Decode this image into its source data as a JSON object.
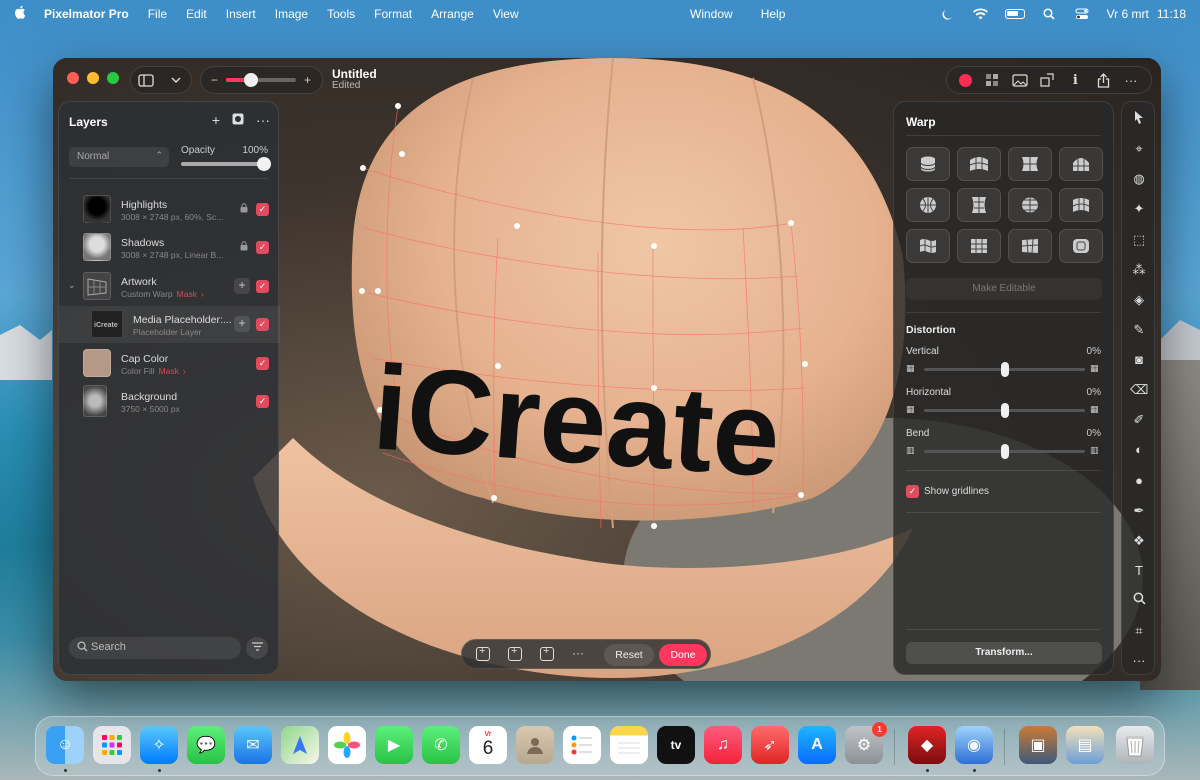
{
  "menubar": {
    "app_name": "Pixelmator Pro",
    "menus": [
      "File",
      "Edit",
      "Insert",
      "Image",
      "Tools",
      "Format",
      "Arrange",
      "View"
    ],
    "center_menus": [
      "Window",
      "Help"
    ],
    "date": "Vr 6 mrt",
    "time": "11:18"
  },
  "window": {
    "title": "Untitled",
    "subtitle": "Edited",
    "zoom_fraction": 0.35
  },
  "layers": {
    "title": "Layers",
    "blend_mode": "Normal",
    "opacity_label": "Opacity",
    "opacity_value": "100%",
    "search_placeholder": "Search",
    "items": [
      {
        "name": "Highlights",
        "desc": "3008 × 2748 px, 60%, Sc...",
        "mask": "",
        "locked": true
      },
      {
        "name": "Shadows",
        "desc": "3008 × 2748 px, Linear B...",
        "mask": "",
        "locked": true
      },
      {
        "name": "Artwork",
        "desc": "Custom Warp",
        "mask": "Mask",
        "locked": false
      },
      {
        "name": "Media Placeholder:...",
        "desc": "Placeholder Layer",
        "mask": "",
        "locked": false
      },
      {
        "name": "Cap Color",
        "desc": "Color Fill",
        "mask": "Mask",
        "locked": false
      },
      {
        "name": "Background",
        "desc": "3750 × 5000 px",
        "mask": "",
        "locked": false
      }
    ]
  },
  "canvas": {
    "artwork_text": "iCreate"
  },
  "warp": {
    "title": "Warp",
    "make_editable": "Make Editable",
    "distortion_title": "Distortion",
    "sliders": [
      {
        "label": "Vertical",
        "value": "0%",
        "fraction": 0.5
      },
      {
        "label": "Horizontal",
        "value": "0%",
        "fraction": 0.5
      },
      {
        "label": "Bend",
        "value": "0%",
        "fraction": 0.5
      }
    ],
    "show_gridlines": "Show gridlines",
    "transform": "Transform..."
  },
  "actions": {
    "reset": "Reset",
    "done": "Done",
    "more": "···"
  },
  "dock": {
    "calendar_month": "Vr",
    "calendar_day": "6",
    "settings_badge": "1",
    "apps": [
      "Finder",
      "Launchpad",
      "Safari",
      "Messages",
      "Mail",
      "Maps",
      "Photos",
      "FaceTime",
      "Phone",
      "Calendar",
      "Contacts",
      "Reminders",
      "Notes",
      "TV",
      "Music",
      "Rocket",
      "App Store",
      "System Settings",
      "Pixelmator Pro",
      "Preview",
      "Photos Folder",
      "Downloads",
      "Trash"
    ]
  },
  "colors": {
    "accent": "#ff375f",
    "cap": "#e8b898",
    "check": "#e04b5e"
  }
}
